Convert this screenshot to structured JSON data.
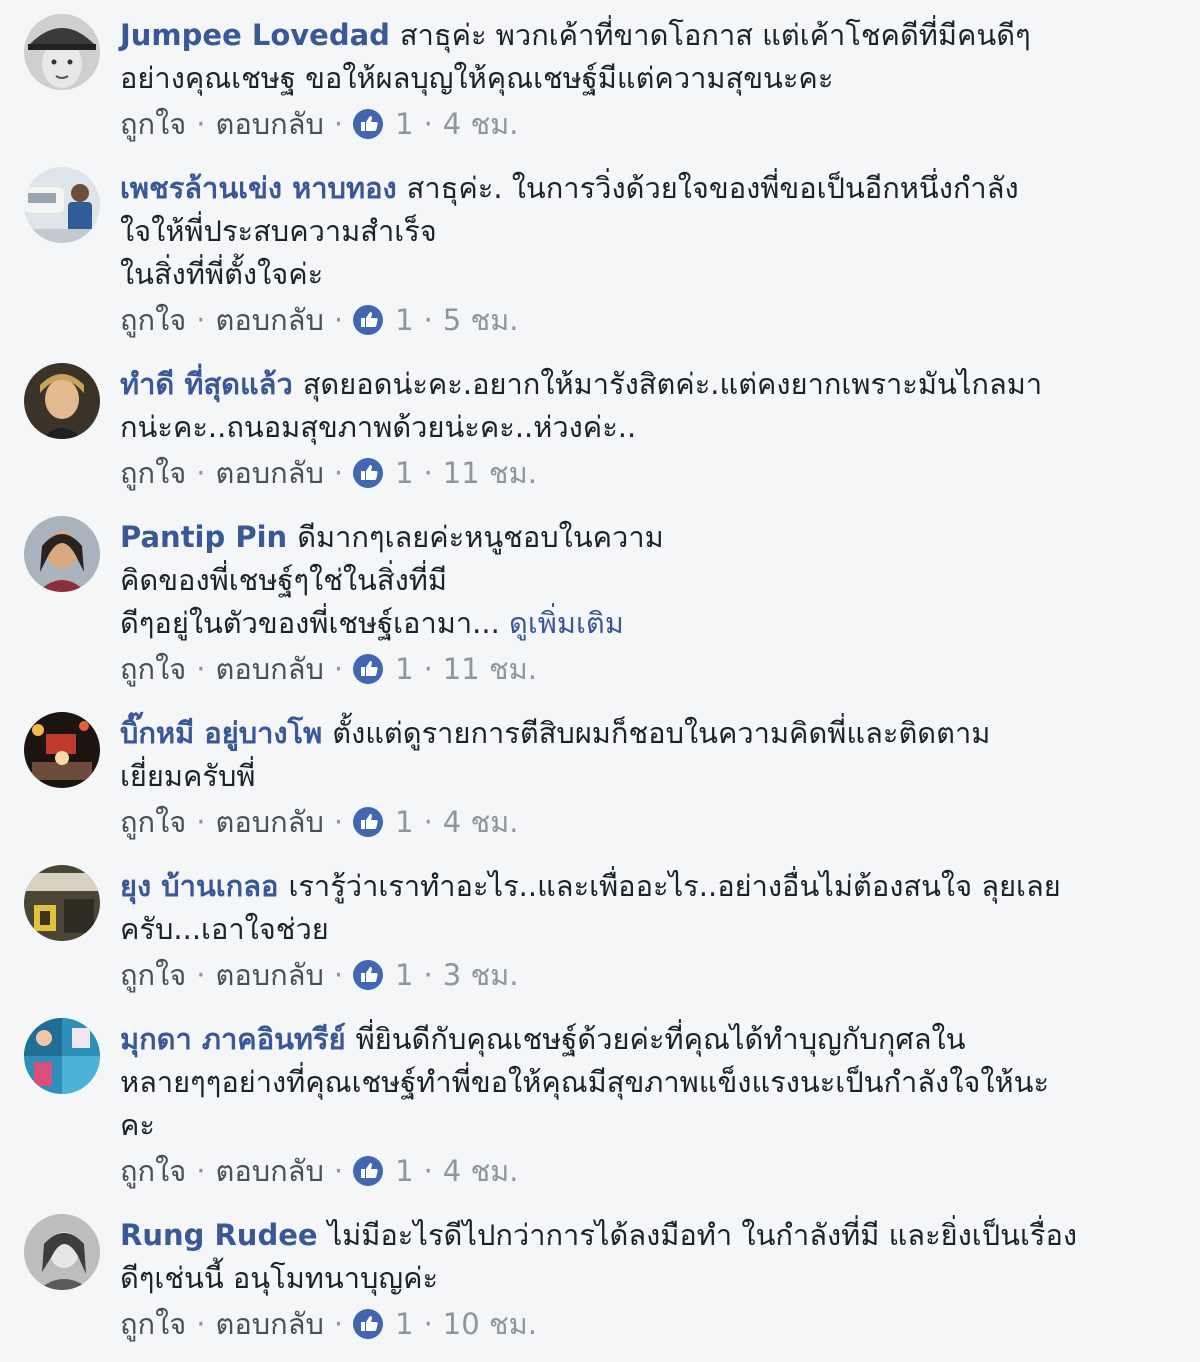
{
  "labels": {
    "like": "ถูกใจ",
    "reply": "ตอบกลับ",
    "dot": "·"
  },
  "colors": {
    "author": "#385898",
    "text": "#1d2129",
    "meta": "#90949c",
    "like_badge": "#4267b2"
  },
  "comments": [
    {
      "author": "Jumpee Lovedad",
      "lines": [
        "สาธุค่ะ พวกเค้าที่ขาดโอกาส แต่เค้าโชคดีที่มีคนดีๆ",
        "อย่างคุณเชษฐ ขอให้ผลบุญให้คุณเชษฐ์มีแต่ความสุขนะคะ"
      ],
      "likes": "1",
      "time": "4 ชม.",
      "avatar": "avatar-cap-man-grayscale"
    },
    {
      "author": "เพชรล้านเข่ง หาบทอง",
      "lines": [
        "สาธุค่ะ. ในการวิ่งด้วยใจของพี่ขอเป็นอีกหนึ่งกำลัง",
        "ใจให้พี่ประสบความสำเร็จ",
        "ในสิ่งที่พี่ตั้งใจค่ะ"
      ],
      "likes": "1",
      "time": "5 ชม.",
      "avatar": "avatar-person-with-car"
    },
    {
      "author": "ทำดี ที่สุดแล้ว",
      "lines": [
        "สุดยอดน่ะคะ.อยากให้มารังสิตค่ะ.แต่คงยากเพราะมันไกลมา",
        "กน่ะคะ..ถนอมสุขภาพด้วยน่ะคะ..ห่วงค่ะ.."
      ],
      "likes": "1",
      "time": "11 ชม.",
      "avatar": "avatar-woman-portrait"
    },
    {
      "author": "Pantip Pin",
      "lines": [
        "ดีมากๆเลยค่ะหนูชอบในความ",
        "คิดของพี่เชษฐ์ๆใช่ในสิ่งที่มี",
        "ดีๆอยู่ในตัวของพี่เชษฐ์เอามา..."
      ],
      "see_more": "ดูเพิ่มเติม",
      "likes": "1",
      "time": "11 ชม.",
      "avatar": "avatar-young-woman"
    },
    {
      "author": "บิ๊กหมี อยู่บางโพ",
      "lines": [
        "ตั้งแต่ดูรายการตีสิบผมก็ชอบในความคิดพี่และติดตาม",
        "เยี่ยมครับพี่"
      ],
      "likes": "1",
      "time": "4 ชม.",
      "avatar": "avatar-night-scene"
    },
    {
      "author": "ยุง บ้านเกลอ",
      "lines": [
        "เรารู้ว่าเราทำอะไร..และเพื่ออะไร..อย่างอื่นไม่ต้องสนใจ ลุยเลย",
        "ครับ...เอาใจช่วย"
      ],
      "likes": "1",
      "time": "3 ชม.",
      "avatar": "avatar-storefront-sign"
    },
    {
      "author": "มุกดา ภาคอินทรีย์",
      "lines": [
        "พี่ยินดีกับคุณเชษฐ์ด้วยค่ะที่คุณได้ทำบุญกับกุศลใน",
        "หลายๆๆอย่างที่คุณเชษฐ์ทำพี่ขอให้คุณมีสุขภาพแข็งแรงนะเป็นกำลังใจให้นะ",
        "คะ"
      ],
      "likes": "1",
      "time": "4 ชม.",
      "avatar": "avatar-blue-collage"
    },
    {
      "author": "Rung Rudee",
      "lines": [
        "ไม่มีอะไรดีไปกว่าการได้ลงมือทำ ในกำลังที่มี และยิ่งเป็นเรื่อง",
        "ดีๆเช่นนี้ อนุโมทนาบุญค่ะ"
      ],
      "likes": "1",
      "time": "10 ชม.",
      "avatar": "avatar-grayscale-woman"
    }
  ]
}
